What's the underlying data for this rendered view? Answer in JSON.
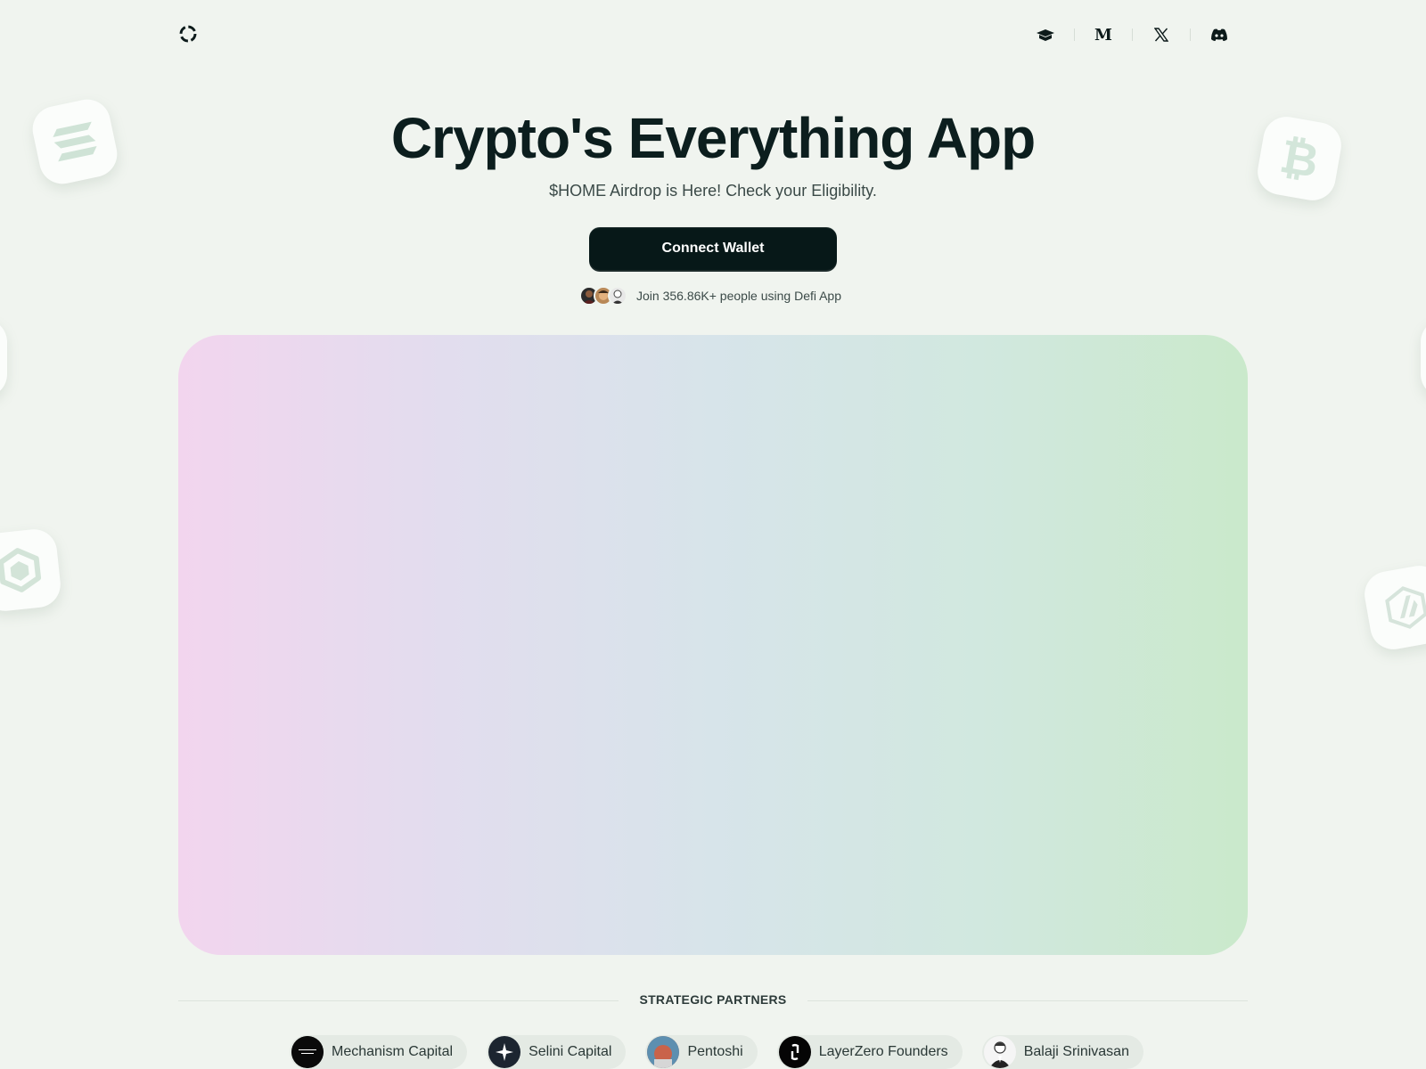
{
  "header": {
    "logo_name": "defi-app-logo",
    "social_icons": [
      "docs-icon",
      "medium-icon",
      "x-icon",
      "discord-icon"
    ],
    "medium_letter": "M"
  },
  "hero": {
    "title": "Crypto's Everything App",
    "subtitle": "$HOME Airdrop is Here! Check your Eligibility.",
    "cta_label": "Connect Wallet",
    "social_proof": "Join 356.86K+ people using Defi App"
  },
  "panel": {
    "gradient_colors": [
      "#f2d5ee",
      "#e2ddee",
      "#d7e4ea",
      "#d1e8df",
      "#cae9cb"
    ]
  },
  "floating_coins": [
    "solana-icon",
    "bitcoin-icon",
    "bnb-icon",
    "arbitrum-icon"
  ],
  "partners": {
    "heading": "STRATEGIC PARTNERS",
    "items": [
      {
        "name": "Mechanism Capital",
        "logo_text": "MECHANISM CAPITAL"
      },
      {
        "name": "Selini Capital"
      },
      {
        "name": "Pentoshi"
      },
      {
        "name": "LayerZero Founders"
      },
      {
        "name": "Balaji Srinivasan"
      }
    ]
  },
  "colors": {
    "background": "#f0f4ef",
    "primary_button": "#071818",
    "title": "#0c1e1e",
    "coin_icon": "#cfe3d6"
  }
}
